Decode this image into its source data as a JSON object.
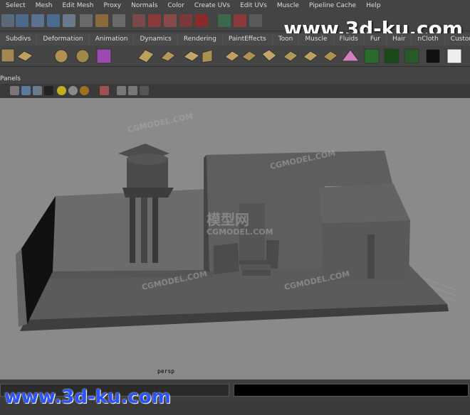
{
  "menu": [
    "Select",
    "Mesh",
    "Edit Mesh",
    "Proxy",
    "Normals",
    "Color",
    "Create UVs",
    "Edit UVs",
    "Muscle",
    "Pipeline Cache",
    "Help"
  ],
  "watermark_top": "www.3d-ku.com",
  "shelf_tabs": [
    "Subdivs",
    "Deformation",
    "Animation",
    "Dynamics",
    "Rendering",
    "PaintEffects",
    "Toon",
    "Muscle",
    "Fluids",
    "Fur",
    "Hair",
    "nCloth",
    "Custom"
  ],
  "panel_menu": "Panels",
  "camera_label": "persp",
  "viewport_watermarks": [
    "CGMODEL.COM",
    "模型网"
  ],
  "watermark_bottom": "www.3d-ku.com",
  "colors": {
    "viewport_bg": "#8a8a8a",
    "model": "#5a5a5a",
    "ui_bg": "#444444"
  }
}
